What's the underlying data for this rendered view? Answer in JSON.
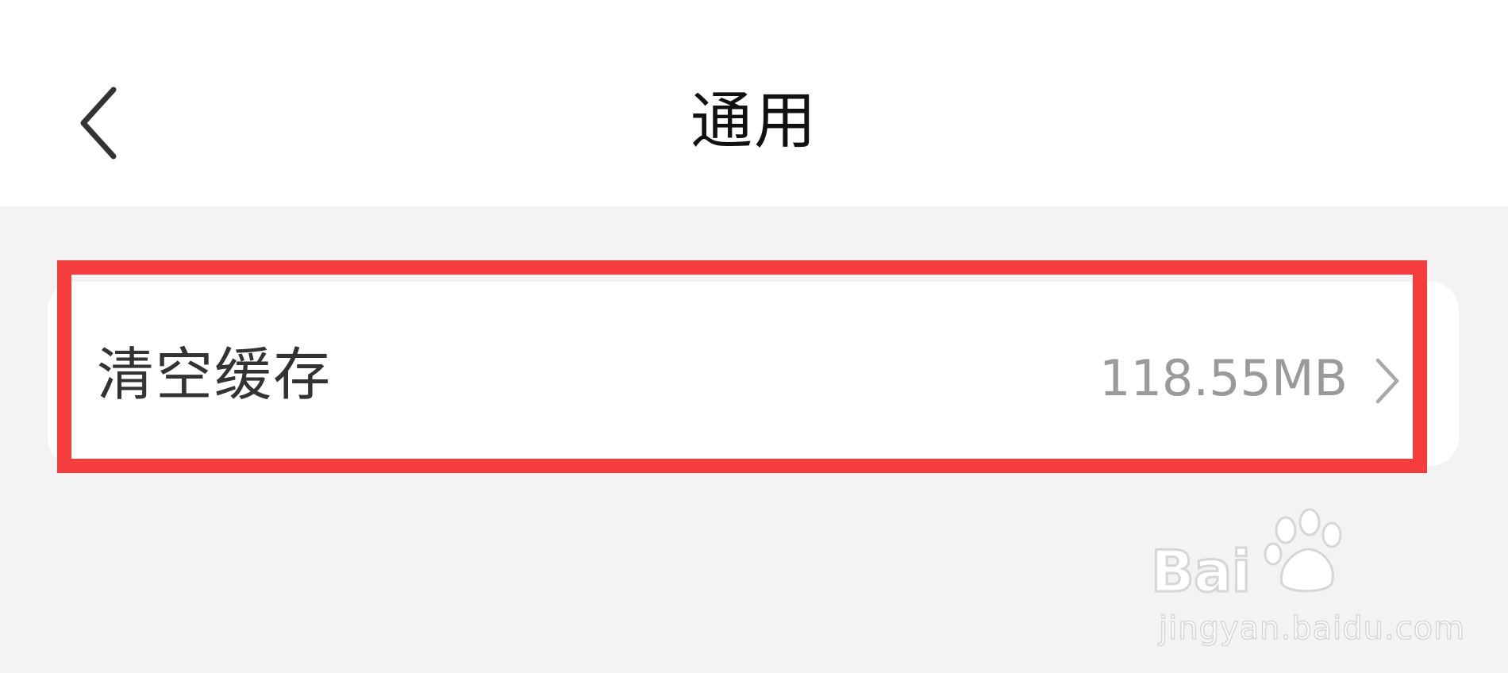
{
  "header": {
    "title": "通用",
    "back_icon": "chevron-left-icon"
  },
  "settings": {
    "items": [
      {
        "label": "清空缓存",
        "value": "118.55MB",
        "icon": "chevron-right-icon"
      }
    ]
  },
  "colors": {
    "background": "#f3f3f3",
    "card": "#ffffff",
    "highlight": "#f53d3d",
    "value_text": "#9a9a9a"
  },
  "watermark": {
    "logo_text": "Baidu经验",
    "url": "jingyan.baidu.com"
  }
}
